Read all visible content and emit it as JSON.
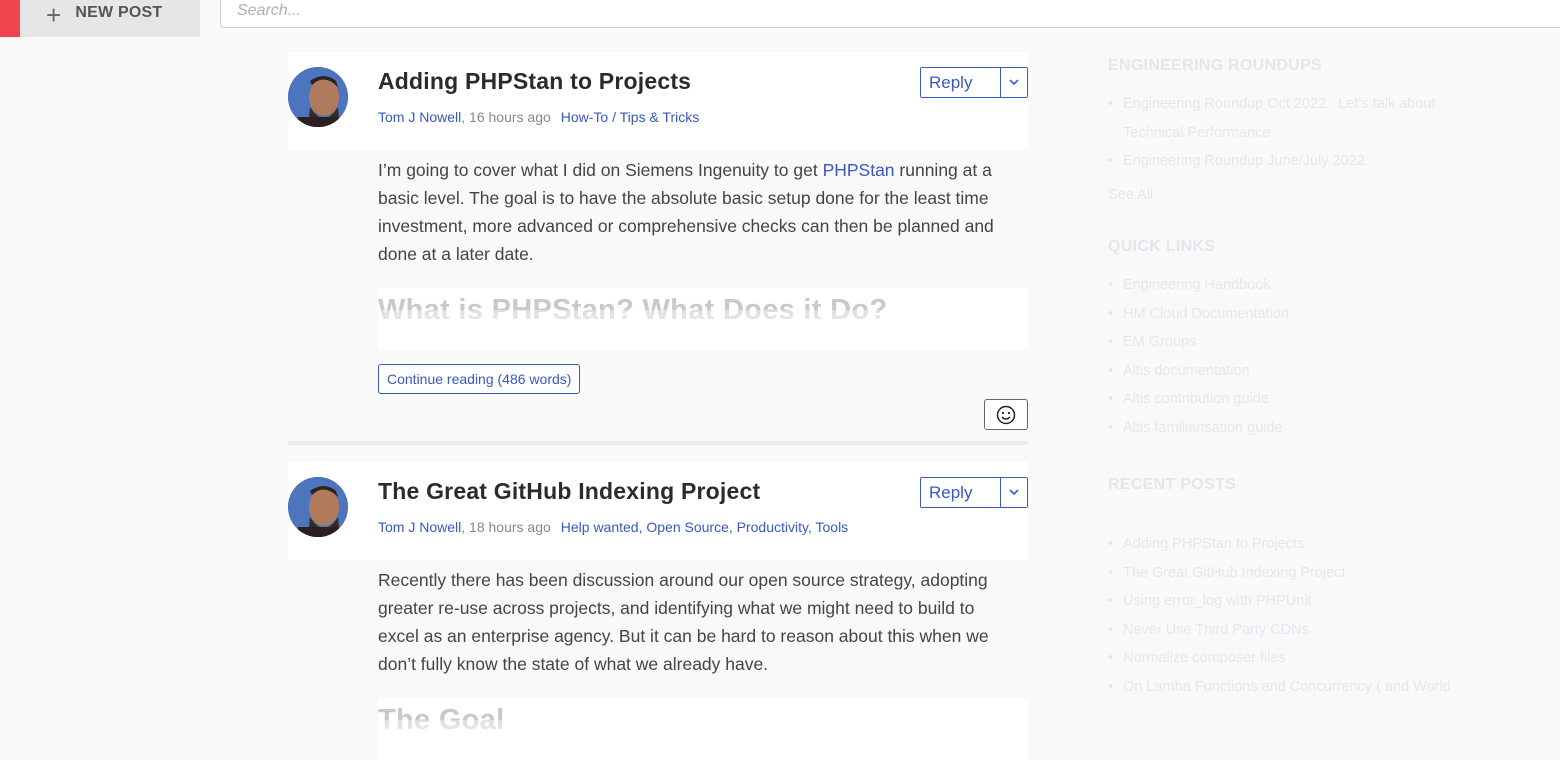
{
  "toolbar": {
    "new_post_label": "NEW POST",
    "search_placeholder": "Search..."
  },
  "posts": [
    {
      "title": "Adding PHPStan to Projects",
      "author": "Tom J Nowell",
      "time": ", 16 hours ago",
      "categories": "How-To / Tips & Tricks",
      "excerpt_before": "I’m going to cover what I did on Siemens Ingenuity to get ",
      "excerpt_link": "PHPStan",
      "excerpt_after": " running at a basic level. The goal is to have the absolute basic setup done for the least time investment, more advanced or comprehensive checks can then be planned and done at a later date.",
      "faded_heading": "What is PHPStan? What Does it Do?",
      "continue_label": "Continue reading (486 words)",
      "reply_label": "Reply"
    },
    {
      "title": "The Great GitHub Indexing Project",
      "author": "Tom J Nowell",
      "time": ", 18 hours ago",
      "categories": "Help wanted, Open Source, Productivity, Tools",
      "excerpt": "Recently there has been discussion around our open source strategy, adopting greater re-use across projects, and identifying what we might need to build to excel as an enterprise agency. But it can be hard to reason about this when we don’t fully know the state of what we already have.",
      "faded_heading": "The Goal",
      "reply_label": "Reply"
    }
  ],
  "sidebar": {
    "roundups": {
      "heading": "ENGINEERING ROUNDUPS",
      "items": [
        "Engineering Roundup Oct 2022 : Let’s talk about",
        "Technical Performance",
        "Engineering Roundup June/July 2022"
      ],
      "see_all": "See All"
    },
    "quick_links": {
      "heading": "QUICK LINKS",
      "items": [
        "Engineering Handbook",
        "HM Cloud Documentation",
        "EM Groups",
        "Altis documentation",
        "Altis contribution guide",
        "Altis familiarisation guide"
      ]
    },
    "recent_posts": {
      "heading": "RECENT POSTS",
      "items": [
        "Adding PHPStan to Projects",
        "The Great GitHub Indexing Project",
        "Using error_log with PHPUnit",
        "Never Use Third Party CDNs",
        "Normalize composer files",
        "On Lamba Functions and Concurrency ( and World"
      ]
    }
  },
  "colors": {
    "accent": "#3858c4",
    "brand_red": "#f0444f"
  },
  "icons": {
    "new_post": "plus-icon",
    "reply_menu": "chevron-down-icon",
    "reaction": "smiley-icon"
  }
}
